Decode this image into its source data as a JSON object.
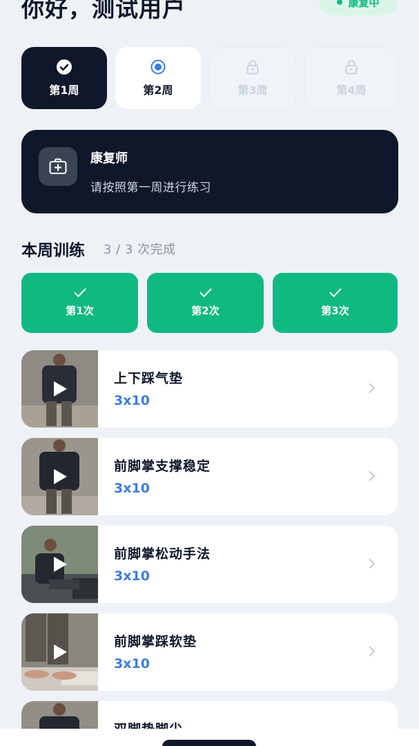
{
  "header": {
    "greeting": "你好，测试用户",
    "status": "康复中"
  },
  "weeks": [
    {
      "label": "第1周",
      "state": "done",
      "icon": "check-circle-icon"
    },
    {
      "label": "第2周",
      "state": "current",
      "icon": "radio-selected-icon"
    },
    {
      "label": "第3周",
      "state": "locked",
      "icon": "lock-icon"
    },
    {
      "label": "第4周",
      "state": "locked",
      "icon": "lock-icon"
    }
  ],
  "therapist": {
    "icon": "medical-kit-icon",
    "title": "康复师",
    "message": "请按照第一周进行练习"
  },
  "training": {
    "title": "本周训练",
    "progress": "3 / 3 次完成",
    "sessions": [
      {
        "label": "第1次",
        "done": true
      },
      {
        "label": "第2次",
        "done": true
      },
      {
        "label": "第3次",
        "done": true
      }
    ]
  },
  "exercises": [
    {
      "name": "上下踩气垫",
      "reps": "3x10"
    },
    {
      "name": "前脚掌支撑稳定",
      "reps": "3x10"
    },
    {
      "name": "前脚掌松动手法",
      "reps": "3x10"
    },
    {
      "name": "前脚掌踩软垫",
      "reps": "3x10"
    },
    {
      "name": "双脚垫脚尖",
      "reps": ""
    }
  ],
  "colors": {
    "dark": "#0f172a",
    "green": "#10b981",
    "blue": "#3b7ddd",
    "background": "#eef2f7"
  }
}
